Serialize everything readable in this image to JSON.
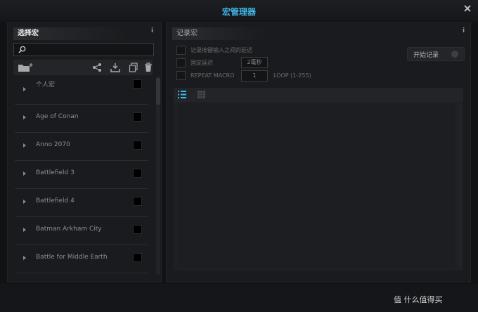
{
  "window": {
    "title": "宏管理器",
    "accent": "#3fb6e8"
  },
  "left_panel": {
    "title": "选择宏",
    "info": "i",
    "search": {
      "value": "",
      "placeholder": ""
    },
    "toolbar": {
      "icons": [
        "folder-add-icon",
        "share-icon",
        "export-icon",
        "copy-icon",
        "trash-icon"
      ]
    },
    "items": [
      {
        "label": "个人宏"
      },
      {
        "label": "Age of Conan"
      },
      {
        "label": "Anno 2070"
      },
      {
        "label": "Battlefield 3"
      },
      {
        "label": "Battlefield 4"
      },
      {
        "label": "Batman Arkham City"
      },
      {
        "label": "Battle for Middle Earth"
      }
    ]
  },
  "right_panel": {
    "title": "记录宏",
    "info": "i",
    "options": {
      "record_delay_label": "记录按键输入之间的延迟",
      "fixed_delay_label": "固定延迟",
      "fixed_delay_value": "2毫秒",
      "repeat_label": "REPEAT MACRO",
      "repeat_value": "1",
      "loop_label": "LOOP (1-255)"
    },
    "record_button": "开始记录"
  },
  "watermark": "值 什么值得买"
}
